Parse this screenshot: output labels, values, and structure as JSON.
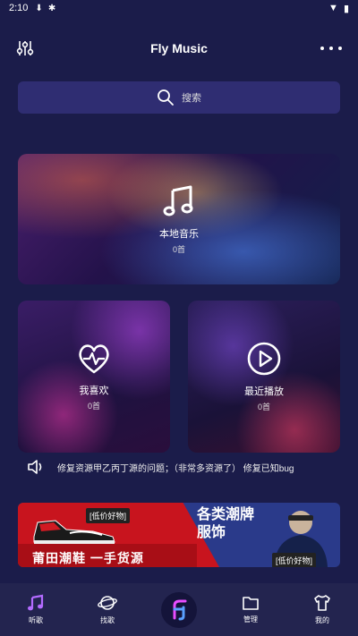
{
  "status_bar": {
    "time": "2:10"
  },
  "header": {
    "title": "Fly Music"
  },
  "search": {
    "placeholder": "搜索"
  },
  "cards": {
    "local": {
      "label": "本地音乐",
      "count": "0首"
    },
    "favorites": {
      "label": "我喜欢",
      "count": "0首"
    },
    "recent": {
      "label": "最近播放",
      "count": "0首"
    }
  },
  "notice": {
    "text": "修复资源甲乙丙丁源的问题；（非常多资源了） 修复已知bug"
  },
  "ad": {
    "tag_left": "[低价好物]",
    "slogan_left": "莆田潮鞋  一手货源",
    "title_right_1": "各类潮牌",
    "title_right_2": "服饰",
    "tag_right": "[低价好物]"
  },
  "tabbar": {
    "tabs": [
      {
        "label": "听歌"
      },
      {
        "label": "找歌"
      },
      {
        "label": "管理"
      },
      {
        "label": "我的"
      }
    ]
  },
  "colors": {
    "background": "#1b1c4a",
    "search_bg": "#2f2d72",
    "tabbar_bg": "#23244f",
    "accent": "#b36bff"
  }
}
